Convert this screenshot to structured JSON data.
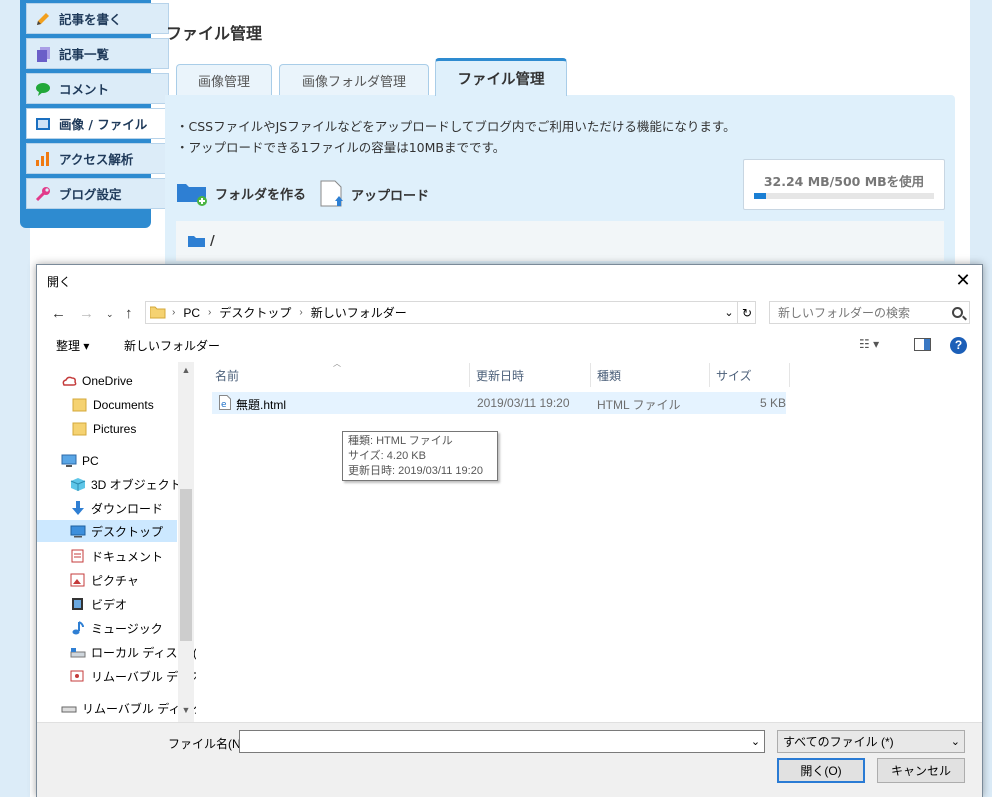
{
  "sidebar": {
    "items": [
      {
        "label": "記事を書く",
        "icon": "pencil-icon",
        "color": "#f2a01e"
      },
      {
        "label": "記事一覧",
        "icon": "documents-icon",
        "color": "#6b5fc8"
      },
      {
        "label": "コメント",
        "icon": "speech-bubble-icon",
        "color": "#22a83a"
      },
      {
        "label": "画像 / ファイル",
        "icon": "image-icon",
        "color": "#1a6fc0"
      },
      {
        "label": "アクセス解析",
        "icon": "bar-chart-icon",
        "color": "#f07a12"
      },
      {
        "label": "ブログ設定",
        "icon": "wrench-icon",
        "color": "#e23a8a"
      }
    ]
  },
  "page": {
    "title": "ファイル管理",
    "tabs": [
      {
        "label": "画像管理"
      },
      {
        "label": "画像フォルダ管理"
      },
      {
        "label": "ファイル管理"
      }
    ],
    "info": [
      "・CSSファイルやJSファイルなどをアップロードしてブログ内でご利用いただける機能になります。",
      "・アップロードできる1ファイルの容量は10MBまでです。"
    ],
    "create_folder": "フォルダを作る",
    "upload": "アップロード",
    "usage_text": "32.24 MB/500 MBを使用",
    "usage_fraction": 0.0645,
    "path": "/"
  },
  "dialog": {
    "title": "開く",
    "close": "✕",
    "breadcrumb": [
      "PC",
      "デスクトップ",
      "新しいフォルダー"
    ],
    "search_placeholder": "新しいフォルダーの検索",
    "toolbar": {
      "organize": "整理 ▾",
      "new_folder": "新しいフォルダー"
    },
    "nav": [
      {
        "label": "OneDrive",
        "icon": "onedrive-icon"
      },
      {
        "label": "Documents",
        "icon": "folder-icon"
      },
      {
        "label": "Pictures",
        "icon": "folder-icon"
      },
      {
        "label": "PC",
        "icon": "pc-icon"
      },
      {
        "label": "3D オブジェクト",
        "icon": "3d-objects-icon"
      },
      {
        "label": "ダウンロード",
        "icon": "download-icon"
      },
      {
        "label": "デスクトップ",
        "icon": "desktop-icon"
      },
      {
        "label": "ドキュメント",
        "icon": "documents-icon"
      },
      {
        "label": "ピクチャ",
        "icon": "pictures-icon"
      },
      {
        "label": "ビデオ",
        "icon": "video-icon"
      },
      {
        "label": "ミュージック",
        "icon": "music-icon"
      },
      {
        "label": "ローカル ディスク (C",
        "icon": "local-disk-icon"
      },
      {
        "label": "リムーバブル ディスク",
        "icon": "removable-disk-icon"
      },
      {
        "label": "リムーバブル ディスク",
        "icon": "removable-drive-icon"
      }
    ],
    "columns": [
      "名前",
      "更新日時",
      "種類",
      "サイズ"
    ],
    "files": [
      {
        "name": "無題.html",
        "modified": "2019/03/11 19:20",
        "type": "HTML ファイル",
        "size": "5 KB",
        "icon": "html-file-icon"
      }
    ],
    "tooltip": [
      "種類: HTML ファイル",
      "サイズ: 4.20 KB",
      "更新日時: 2019/03/11 19:20"
    ],
    "filename_label": "ファイル名(N):",
    "filename_value": "",
    "filter": "すべてのファイル (*)",
    "open_button": "開く(O)",
    "cancel_button": "キャンセル"
  }
}
